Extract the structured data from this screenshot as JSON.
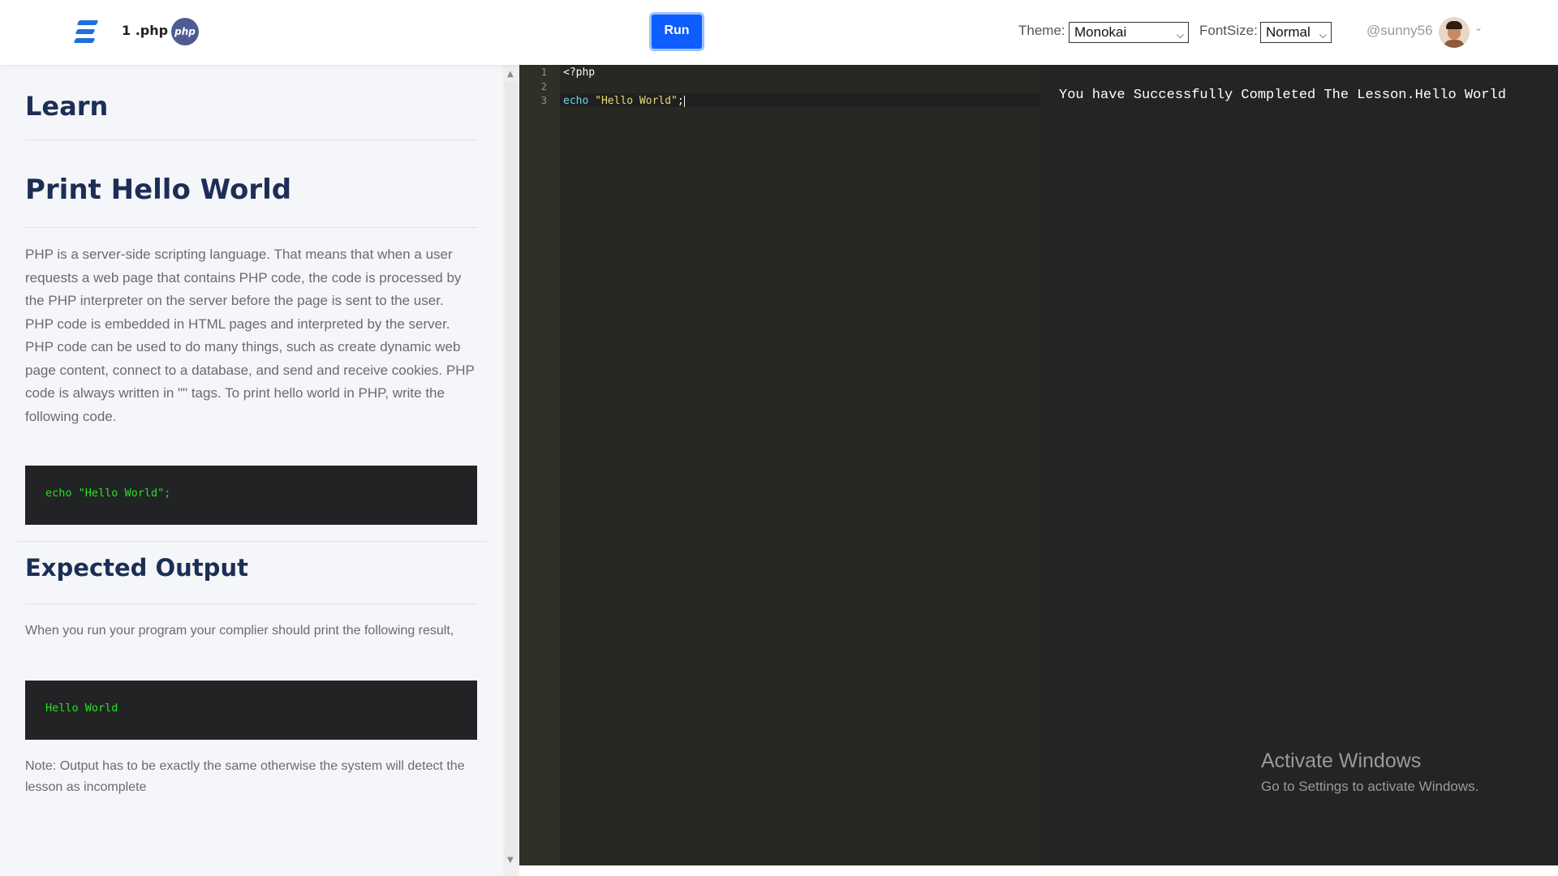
{
  "header": {
    "file_name": "1 .php",
    "php_badge": "php",
    "run_label": "Run",
    "theme_label": "Theme:",
    "theme_value": "Monokai",
    "fontsize_label": "FontSize:",
    "fontsize_value": "Normal",
    "username": "@sunny56"
  },
  "lesson": {
    "learn_title": "Learn",
    "heading": "Print Hello World",
    "description": "PHP is a server-side scripting language. That means that when a user requests a web page that contains PHP code, the code is processed by the PHP interpreter on the server before the page is sent to the user. PHP code is embedded in HTML pages and interpreted by the server. PHP code can be used to do many things, such as create dynamic web page content, connect to a database, and send and receive cookies. PHP code is always written in \"\" tags. To print hello world in PHP, write the following code.",
    "example_code": "echo \"Hello World\";",
    "expected_heading": "Expected Output",
    "expected_text": "When you run your program your complier should print the following result,",
    "expected_output": "Hello World",
    "note": "Note: Output has to be exactly the same otherwise the system will detect the lesson as incomplete"
  },
  "editor": {
    "line_numbers": [
      "1",
      "2",
      "3"
    ],
    "line1": "<?php",
    "line3_keyword": "echo",
    "line3_string": "\"Hello World\"",
    "line3_end": ";"
  },
  "output": {
    "text": "You have Successfully Completed The Lesson.Hello World"
  },
  "watermark": {
    "title": "Activate Windows",
    "subtitle": "Go to Settings to activate Windows."
  },
  "colors": {
    "accent": "#0d5dff",
    "heading": "#1d2e56",
    "editor_bg": "#272822",
    "output_bg": "#242424",
    "code_green": "#27e027"
  }
}
